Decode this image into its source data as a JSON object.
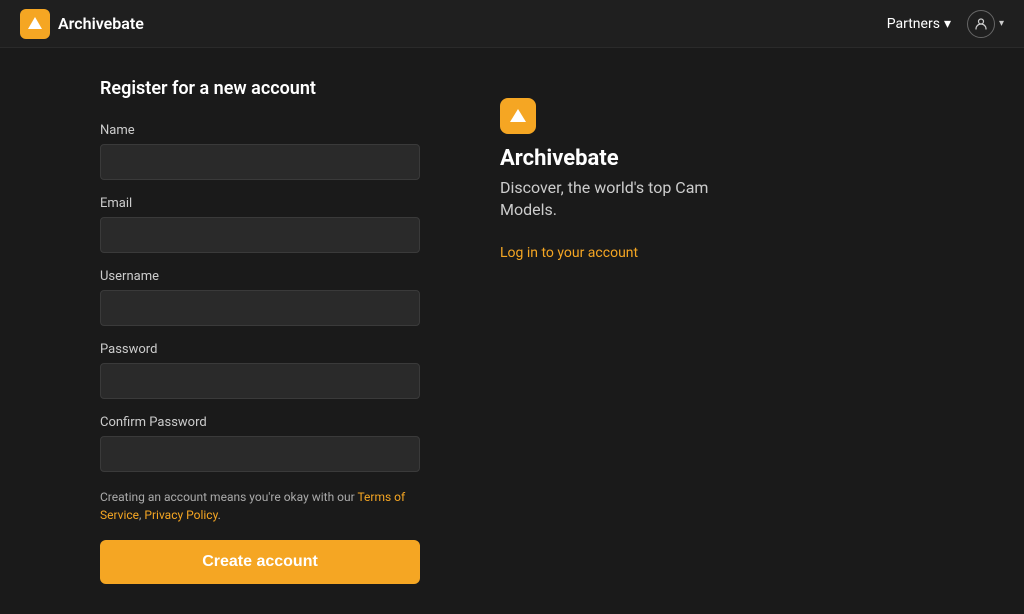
{
  "navbar": {
    "brand_name": "Archivebate",
    "partners_label": "Partners",
    "chevron": "▾"
  },
  "form": {
    "title": "Register for a new account",
    "name_label": "Name",
    "email_label": "Email",
    "username_label": "Username",
    "password_label": "Password",
    "confirm_password_label": "Confirm Password",
    "terms_text_before": "Creating an account means you're okay with our ",
    "terms_of_service": "Terms of Service",
    "terms_comma": ", ",
    "privacy_policy": "Privacy Policy",
    "terms_text_after": ".",
    "create_button": "Create account"
  },
  "info": {
    "app_name": "Archivebate",
    "tagline": "Discover, the world's top Cam Models.",
    "login_link": "Log in to your account"
  },
  "colors": {
    "accent": "#f5a623",
    "background": "#1a1a1a",
    "navbar_bg": "#1f1f1f",
    "input_bg": "#2a2a2a"
  }
}
